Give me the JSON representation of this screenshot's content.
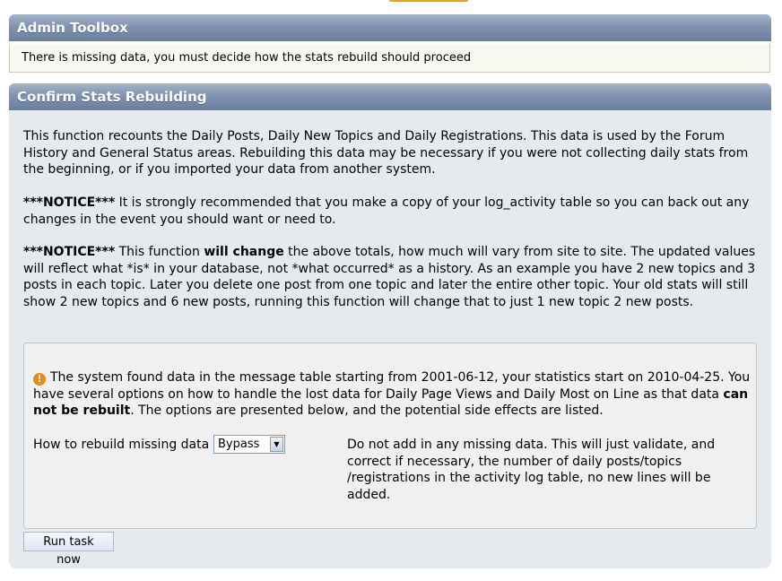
{
  "admin_toolbox": {
    "title": "Admin Toolbox",
    "message": "There is missing data, you must decide how the stats rebuild should proceed"
  },
  "confirm": {
    "title": "Confirm Stats Rebuilding",
    "description": "This function recounts the Daily Posts, Daily New Topics and Daily Registrations. This data is used by the Forum History and General Status areas. Rebuilding this data may be necessary if you were not collecting daily stats from the beginning, or if you imported your data from another system.",
    "notice1": {
      "label": "***NOTICE***",
      "text": " It is strongly recommended that you make a copy of your log_activity table so you can back out any changes in the event you should want or need to."
    },
    "notice2": {
      "label": "***NOTICE***",
      "text_before": " This function ",
      "bold": "will change",
      "text_after": " the above totals, how much will vary from site to site. The updated values will reflect what *is* in your database, not *what occurred* as a history. As an example you have 2 new topics and 3 posts in each topic. Later you delete one post from one topic and later the entire other topic. Your old stats will still show 2 new topics and 6 new posts, running this function will change that to just 1 new topic 2 new posts."
    },
    "warning": {
      "icon": "warning-icon",
      "text_before": "The system found data in the message table starting from 2001-06-12, your statistics start on 2010-04-25. You have several options on how to handle the lost data for Daily Page Views and Daily Most on Line as that data ",
      "bold": "can not be rebuilt",
      "text_after": ". The options are presented below, and the potential side effects are listed."
    },
    "rebuild": {
      "label": "How to rebuild missing data",
      "selected": "Bypass",
      "option_description": "Do not add in any missing data. This will just validate, and correct if necessary, the number of daily posts/topics /registrations in the activity log table, no new lines will be added."
    },
    "run_button": "Run task now"
  },
  "colors": {
    "header_gradient_top": "#a4b3c8",
    "header_gradient_bottom": "#6b7f9d",
    "notice_bg": "#f9f9f1",
    "panel_bg": "#e6eaef",
    "warning": "#e78a1c"
  }
}
